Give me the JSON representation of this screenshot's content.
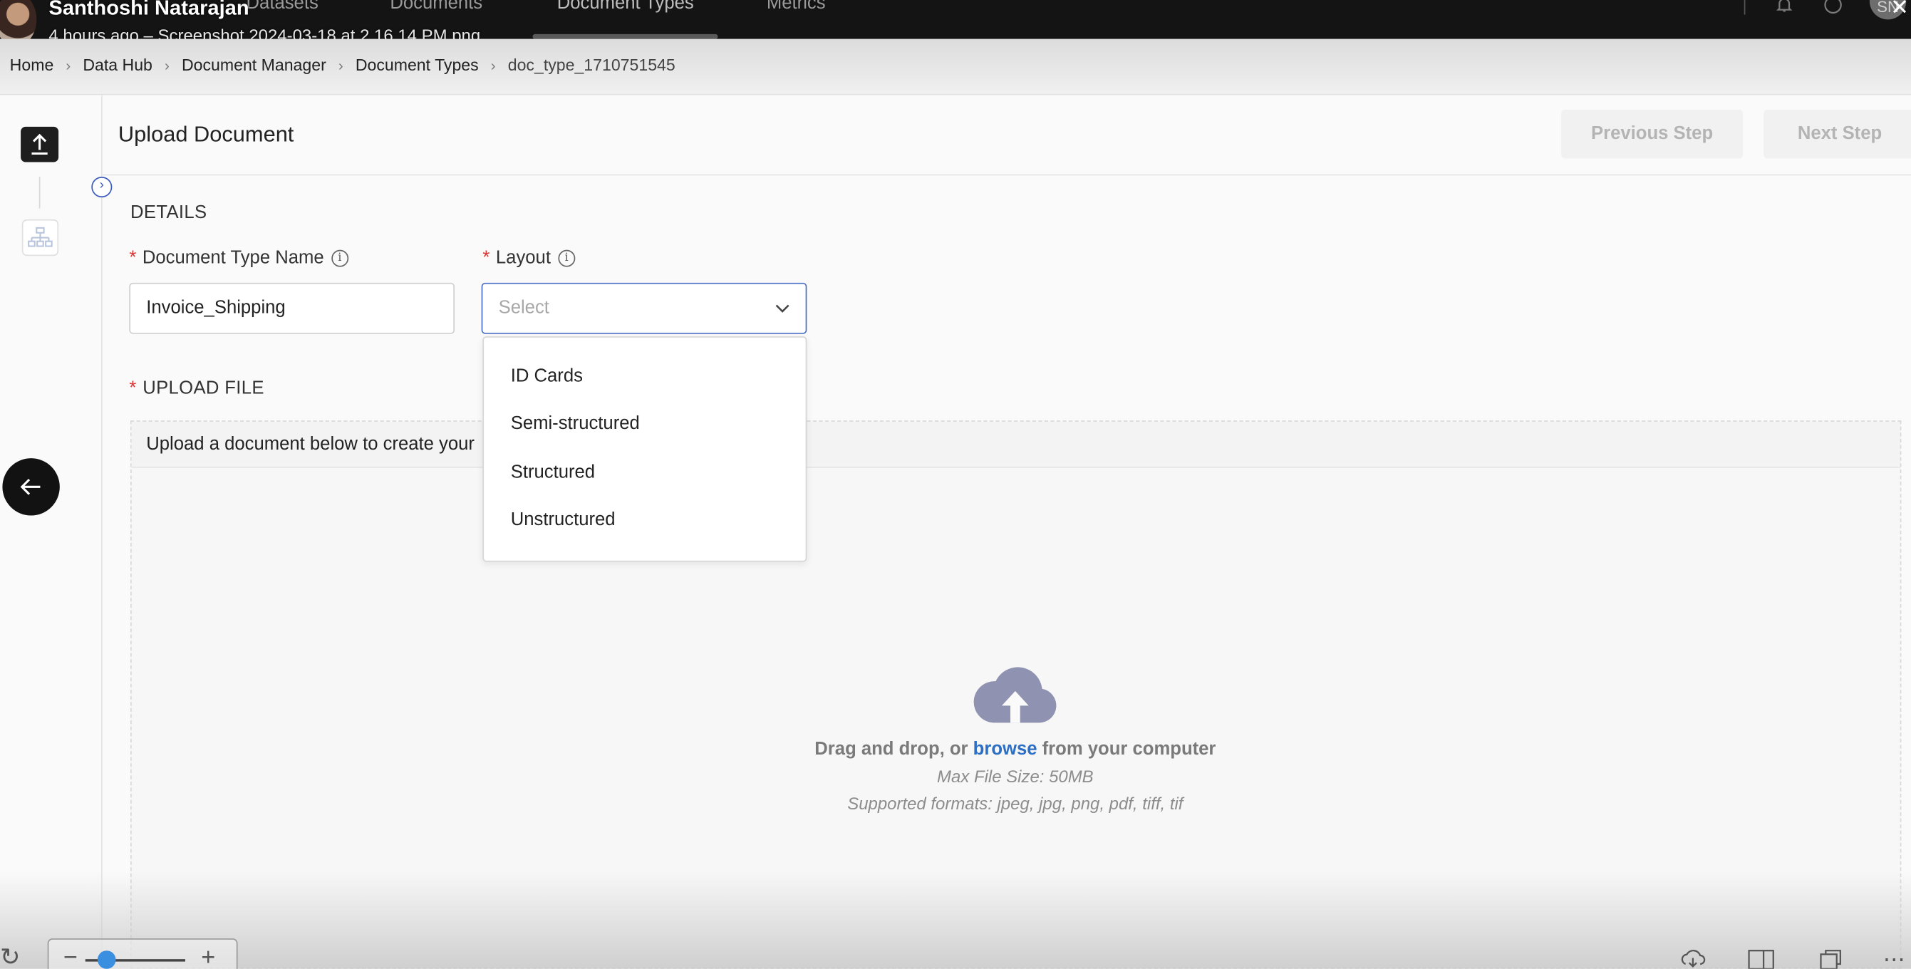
{
  "viewer": {
    "author": "Santhoshi Natarajan",
    "meta": "4 hours ago – Screenshot 2024-03-18 at 2.16.14 PM.png",
    "user_initials": "SN"
  },
  "nav": {
    "tabs": [
      "Datasets",
      "Documents",
      "Document Types",
      "Metrics"
    ],
    "active": "Document Types"
  },
  "breadcrumb": [
    "Home",
    "Data Hub",
    "Document Manager",
    "Document Types",
    "doc_type_1710751545"
  ],
  "page": {
    "title": "Upload Document",
    "prev_step": "Previous Step",
    "next_step": "Next Step"
  },
  "details": {
    "section": "DETAILS",
    "name_label": "Document Type Name",
    "name_value": "Invoice_Shipping",
    "layout_label": "Layout",
    "layout_placeholder": "Select",
    "layout_options": [
      "ID Cards",
      "Semi-structured",
      "Structured",
      "Unstructured"
    ]
  },
  "upload": {
    "section": "UPLOAD FILE",
    "hint": "Upload a document below to create your",
    "drag_prefix": "Drag and drop, or",
    "browse": "browse",
    "drag_suffix": "from your computer",
    "max_size": "Max File Size: 50MB",
    "formats": "Supported formats: jpeg, jpg, png, pdf, tiff, tif"
  },
  "colors": {
    "accent": "#4a6fc7",
    "required": "#d33333",
    "link": "#2c6fc4",
    "topbar": "#141414"
  }
}
